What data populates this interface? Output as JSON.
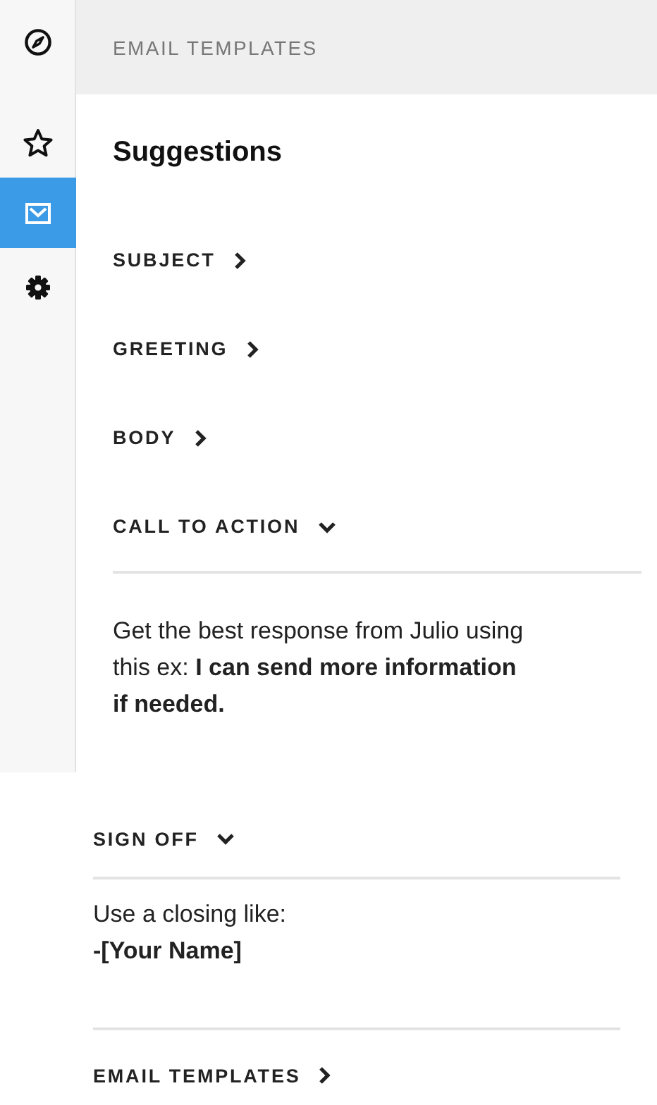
{
  "sidebar": {
    "items": [
      {
        "kind": "compass",
        "selected": false
      },
      {
        "kind": "star",
        "selected": false
      },
      {
        "kind": "mail",
        "selected": true
      },
      {
        "kind": "gear",
        "selected": false
      }
    ]
  },
  "panel": {
    "header": "EMAIL TEMPLATES",
    "title": "Suggestions",
    "sections": [
      {
        "label": "SUBJECT",
        "expanded": false
      },
      {
        "label": "GREETING",
        "expanded": false
      },
      {
        "label": "BODY",
        "expanded": false
      },
      {
        "label": "CALL TO ACTION",
        "expanded": true,
        "description": "Get the best response from Julio using this ex: **I can send more information if needed.**"
      }
    ]
  },
  "lower_panel": {
    "sections": [
      {
        "label": "SIGN OFF",
        "expanded": true,
        "description": "Use a closing like:\n**-[Your Name]**"
      },
      {
        "label": "EMAIL TEMPLATES",
        "expanded": false
      }
    ]
  }
}
